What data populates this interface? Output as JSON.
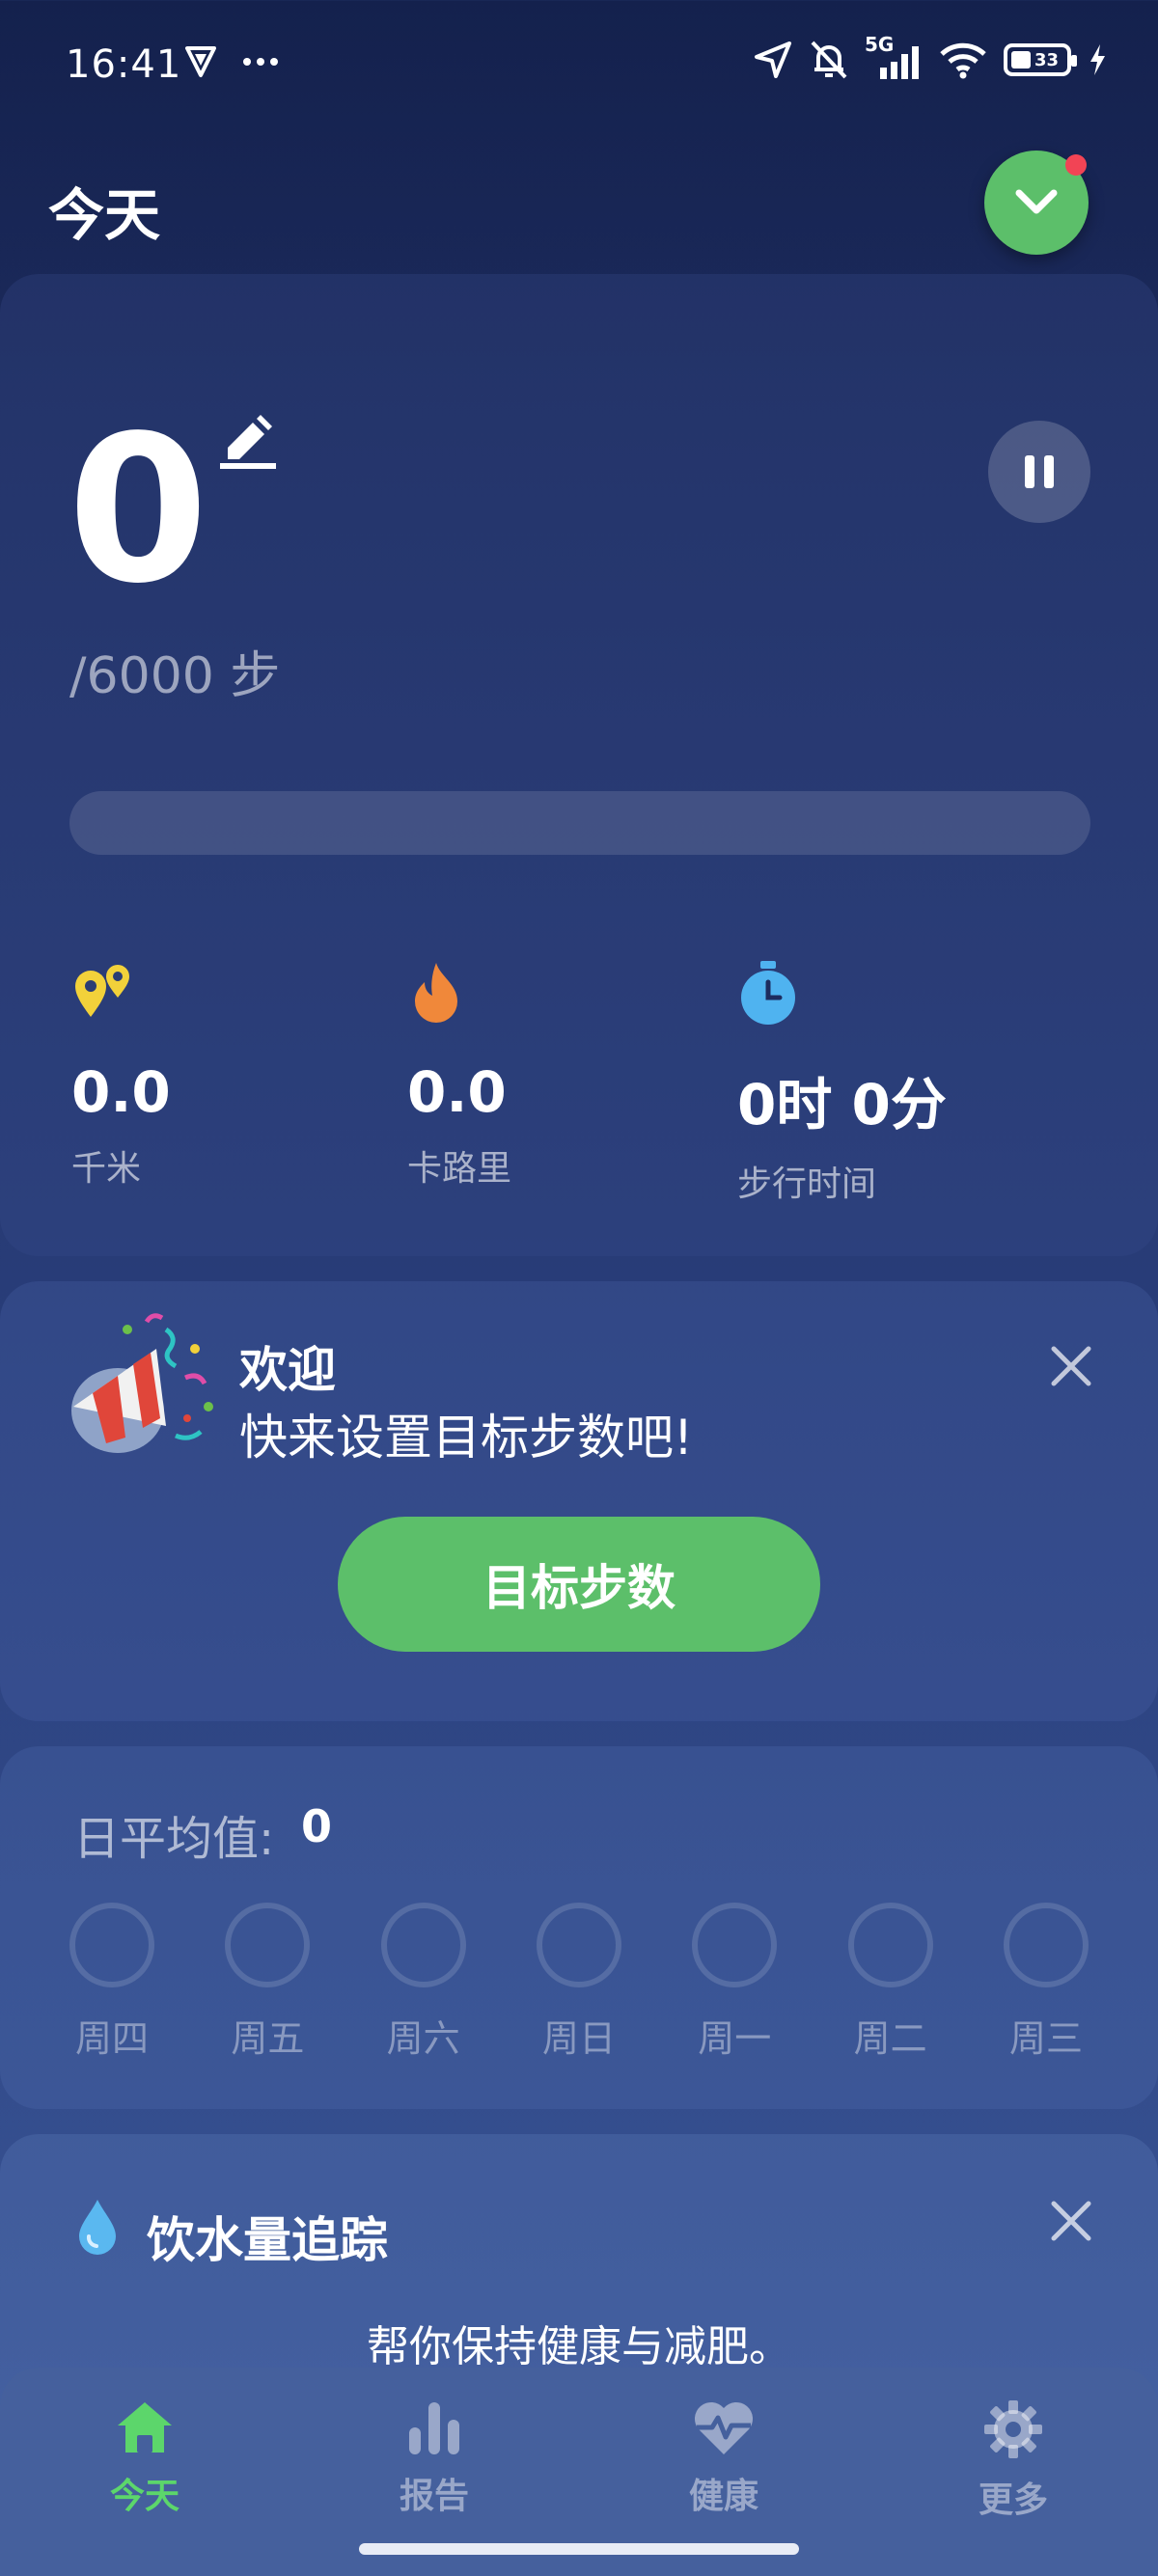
{
  "status_bar": {
    "time": "16:41",
    "network": "5G",
    "battery": "33"
  },
  "header": {
    "title": "今天"
  },
  "steps_card": {
    "steps": "0",
    "goal_text": "/6000 步",
    "progress_fraction": 0,
    "stats": [
      {
        "value": "0.0",
        "label": "千米",
        "icon": "distance-pin-icon",
        "color": "#f2d13a"
      },
      {
        "value": "0.0",
        "label": "卡路里",
        "icon": "flame-icon",
        "color": "#f0883a"
      },
      {
        "value": "0时 0分",
        "label": "步行时间",
        "icon": "stopwatch-icon",
        "color": "#4fb3f0"
      }
    ]
  },
  "welcome_card": {
    "title": "欢迎",
    "text": "快来设置目标步数吧!",
    "button": "目标步数"
  },
  "average_card": {
    "label": "日平均值:",
    "value": "0",
    "days": [
      "周四",
      "周五",
      "周六",
      "周日",
      "周一",
      "周二",
      "周三"
    ]
  },
  "water_card": {
    "title": "饮水量追踪",
    "subtitle": "帮你保持健康与减肥。"
  },
  "bottom_nav": [
    {
      "label": "今天",
      "icon": "home-icon",
      "active": true
    },
    {
      "label": "报告",
      "icon": "bar-chart-icon",
      "active": false
    },
    {
      "label": "健康",
      "icon": "heart-pulse-icon",
      "active": false
    },
    {
      "label": "更多",
      "icon": "gear-icon",
      "active": false
    }
  ],
  "colors": {
    "accent_green": "#5cbf6a",
    "active_nav": "#5cd66b",
    "notification_dot": "#f24455"
  }
}
